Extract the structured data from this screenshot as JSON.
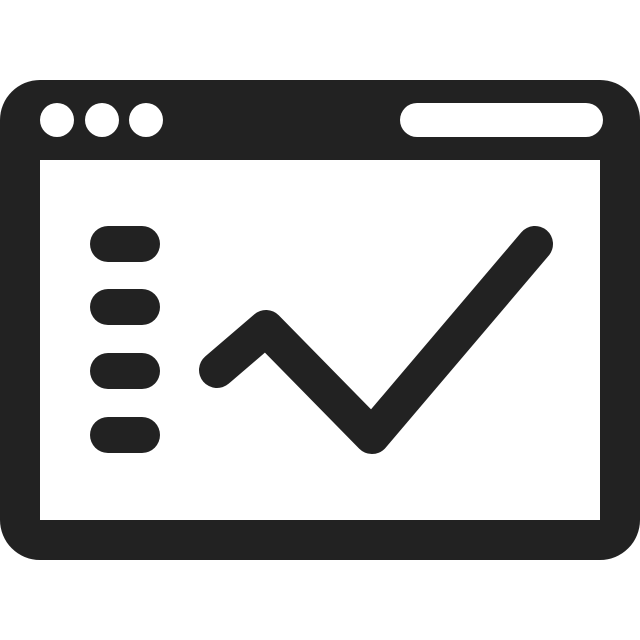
{
  "icon": {
    "name": "browser-window-line-chart-icon",
    "stroke_color": "#222222",
    "fill_color": "#ffffff",
    "background_color": "#ffffff"
  },
  "window": {
    "traffic_lights": [
      "dot",
      "dot",
      "dot"
    ],
    "address_bar": "empty"
  },
  "sidebar": {
    "items": [
      "item",
      "item",
      "item",
      "item"
    ]
  },
  "chart": {
    "type": "line"
  }
}
